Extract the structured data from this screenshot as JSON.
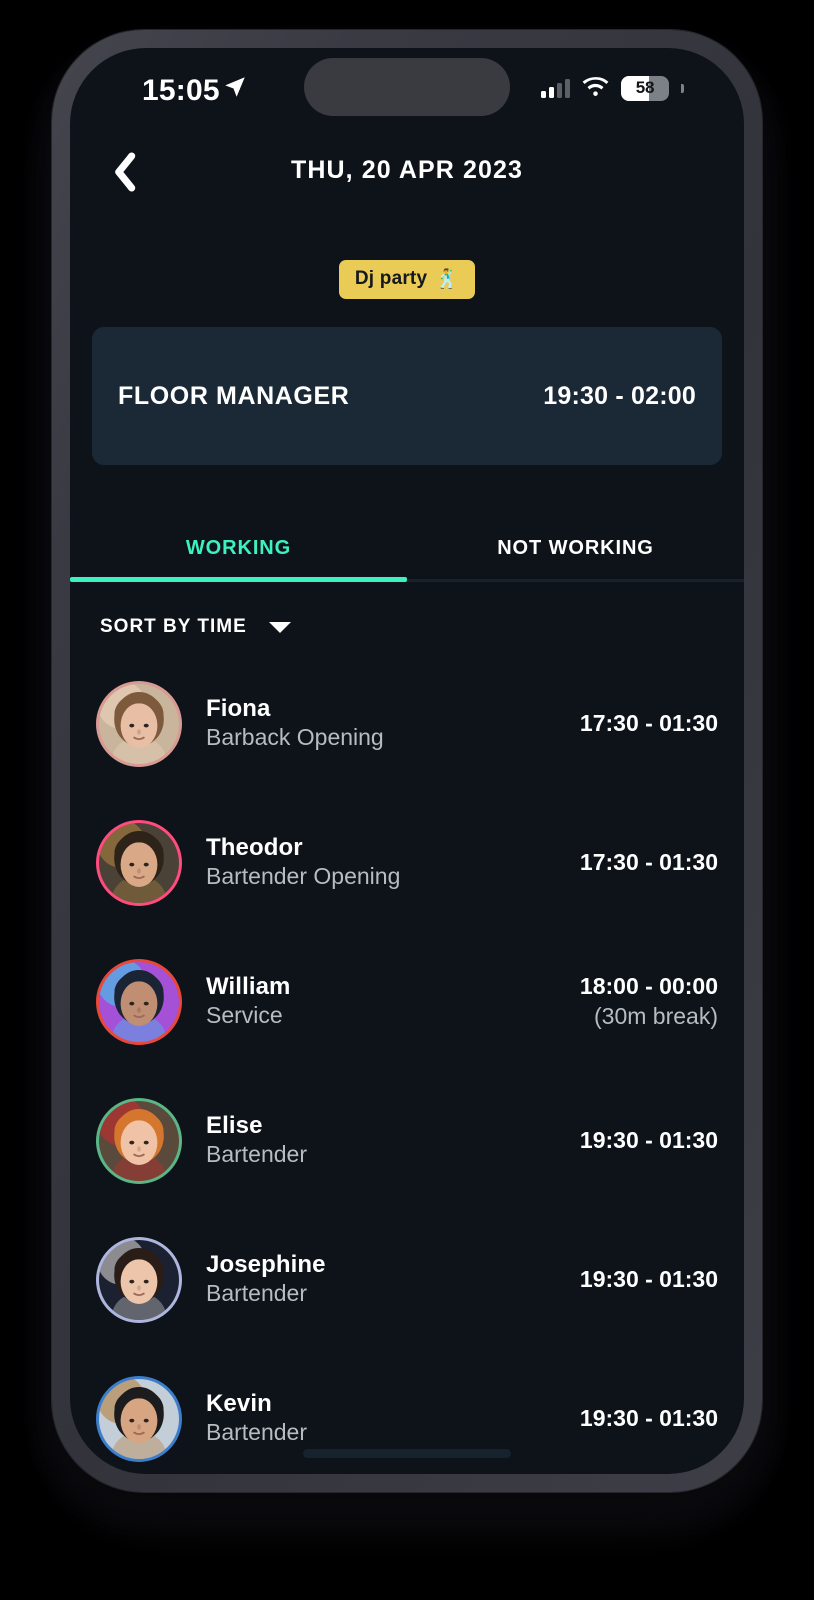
{
  "status_bar": {
    "time": "15:05",
    "location_icon": "location-arrow-icon",
    "signal_icon": "cellular-signal-icon",
    "wifi_icon": "wifi-icon",
    "battery_level": "58",
    "battery_percent": 58
  },
  "nav": {
    "back_icon": "chevron-left-icon",
    "title": "THU, 20 APR 2023"
  },
  "event_tag": {
    "label": "Dj party",
    "emoji": "🕺",
    "bg_color": "#E9CB56",
    "text_color": "#15181C"
  },
  "role_card": {
    "title": "FLOOR MANAGER",
    "time": "19:30 - 02:00",
    "bg_color": "#1B2936"
  },
  "tabs": {
    "items": [
      {
        "label": "WORKING",
        "active": true
      },
      {
        "label": "NOT WORKING",
        "active": false
      }
    ],
    "active_color": "#3DF2BF"
  },
  "sort": {
    "label": "SORT BY TIME",
    "caret_icon": "caret-down-icon"
  },
  "people": [
    {
      "name": "Fiona",
      "role": "Barback Opening",
      "time": "17:30 - 01:30",
      "break": "",
      "ring_color": "#D99A94",
      "avatar": {
        "skin": "#e8bfa5",
        "hair": "#7d5a3c",
        "bg": "#c9b49c",
        "accent": "#f0d6c0"
      }
    },
    {
      "name": "Theodor",
      "role": "Bartender Opening",
      "time": "17:30 - 01:30",
      "break": "",
      "ring_color": "#FF4B7D",
      "avatar": {
        "skin": "#d9a887",
        "hair": "#2e2318",
        "bg": "#4a4237",
        "accent": "#b5863f"
      }
    },
    {
      "name": "William",
      "role": "Service",
      "time": "18:00 - 00:00",
      "break": "(30m break)",
      "ring_color": "#E8483A",
      "avatar": {
        "skin": "#c08e72",
        "hair": "#1a2435",
        "bg": "#a451d8",
        "accent": "#32d8e8"
      }
    },
    {
      "name": "Elise",
      "role": "Bartender",
      "time": "19:30 - 01:30",
      "break": "",
      "ring_color": "#5BB686",
      "avatar": {
        "skin": "#f0c3a6",
        "hair": "#d4762e",
        "bg": "#5a4a3c",
        "accent": "#d4282c"
      }
    },
    {
      "name": "Josephine",
      "role": "Bartender",
      "time": "19:30 - 01:30",
      "break": "",
      "ring_color": "#AFB6DE",
      "avatar": {
        "skin": "#edc5ab",
        "hair": "#2a1d18",
        "bg": "#1b2130",
        "accent": "#e8e4e0"
      }
    },
    {
      "name": "Kevin",
      "role": "Bartender",
      "time": "19:30 - 01:30",
      "break": "",
      "ring_color": "#3C7ECB",
      "avatar": {
        "skin": "#d7a582",
        "hair": "#1c1c1e",
        "bg": "#c3ced9",
        "accent": "#b4762c"
      }
    }
  ],
  "screen": {
    "bg_color": "#0D1319",
    "home_indicator": "home-indicator"
  }
}
